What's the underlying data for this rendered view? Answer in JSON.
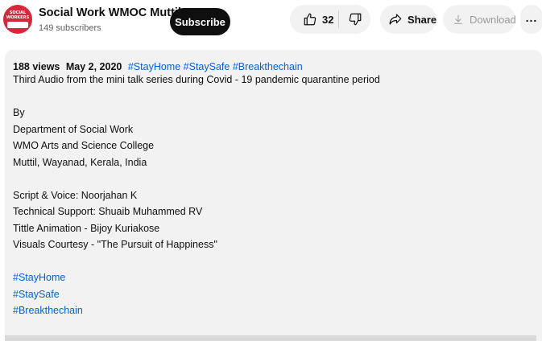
{
  "channel": {
    "avatar_text": "SOCIAL WORKERS",
    "name": "Social Work WMOC Muttil",
    "subscribers": "149 subscribers",
    "subscribe_label": "Subscribe"
  },
  "actions": {
    "like_count": "32",
    "share_label": "Share",
    "download_label": "Download",
    "more_label": "..."
  },
  "description": {
    "views": "188 views",
    "date": "May 2, 2020",
    "meta_tags": [
      "#StayHome",
      "#StaySafe",
      "#Breakthechain"
    ],
    "summary": "Third Audio from the mini talk series during Covid - 19 pandemic quarantine period",
    "by_heading": "By",
    "credits_org": [
      "Department of Social Work",
      "WMO Arts and Science College",
      "Muttil, Wayanad, Kerala, India"
    ],
    "credits_people": [
      "Script & Voice: Noorjahan K",
      "Technical Support: Shuaib Muhammed RV",
      "Tittle Animation - Bijoy Kuriakose",
      "Visuals Courtesy - \"The Pursuit of Happiness\""
    ],
    "footer_tags": [
      "#StayHome",
      "#StaySafe",
      "#Breakthechain"
    ]
  },
  "icons": {
    "like": "thumbs-up-icon",
    "dislike": "thumbs-down-icon",
    "share": "share-arrow-icon",
    "download": "download-icon",
    "more": "more-dots-icon"
  },
  "colors": {
    "hashtag": "#065fd4",
    "subscribe_bg": "#0f0f0f",
    "pill_bg": "#f2f2f2",
    "avatar_bg": "#d8263a"
  }
}
